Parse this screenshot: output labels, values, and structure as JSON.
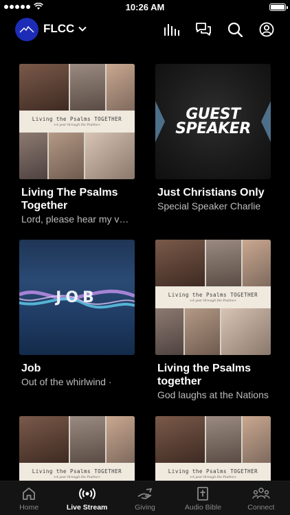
{
  "status_bar": {
    "time": "10:26 AM"
  },
  "header": {
    "brand": "FLCC"
  },
  "cards": [
    {
      "title": "Living The Psalms Together",
      "subtitle": "Lord, please hear my voice",
      "art": "psalms"
    },
    {
      "title": "Just Christians Only",
      "subtitle": "Special Speaker Charlie",
      "art": "guest",
      "art_text": "GUEST SPEAKER"
    },
    {
      "title": "Job",
      "subtitle": "Out of the whirlwind ·",
      "art": "job",
      "art_text": "JOB"
    },
    {
      "title": "Living the Psalms together",
      "subtitle": "God laughs at the Nations",
      "art": "psalms"
    },
    {
      "title": "",
      "subtitle": "",
      "art": "psalms"
    },
    {
      "title": "",
      "subtitle": "",
      "art": "psalms"
    }
  ],
  "psalms_art": {
    "banner_title": "Living the Psalms TOGETHER",
    "banner_subtitle": "+A year through the Psalms+"
  },
  "tabs": [
    {
      "label": "Home",
      "icon": "home-icon"
    },
    {
      "label": "Live Stream",
      "icon": "live-stream-icon"
    },
    {
      "label": "Giving",
      "icon": "giving-icon"
    },
    {
      "label": "Audio Bible",
      "icon": "audio-bible-icon"
    },
    {
      "label": "Connect",
      "icon": "connect-icon"
    }
  ],
  "active_tab": "Live Stream",
  "colors": {
    "background": "#000000",
    "logo": "#1d2cb6",
    "tab_bar": "#141414",
    "muted_text": "#bdbdbd"
  }
}
